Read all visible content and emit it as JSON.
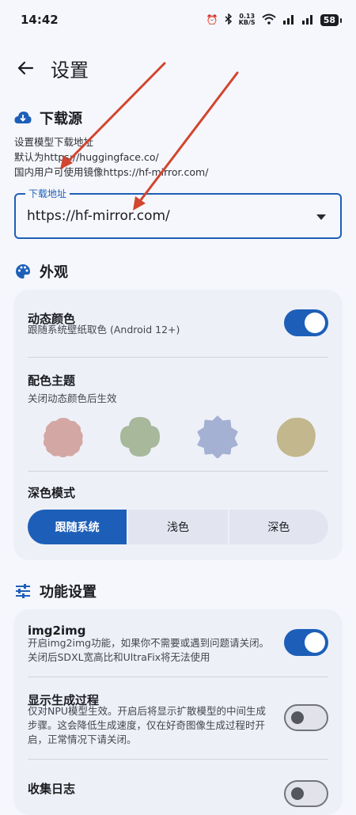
{
  "status_bar": {
    "time": "14:42",
    "net_speed": "0.13",
    "net_unit": "KB/S",
    "battery": "58"
  },
  "topbar": {
    "title": "设置"
  },
  "download": {
    "section_title": "下载源",
    "desc": [
      "设置模型下载地址",
      "默认为https://huggingface.co/",
      "国内用户可使用镜像https://hf-mirror.com/"
    ],
    "field_label": "下载地址",
    "field_value": "https://hf-mirror.com/"
  },
  "appearance": {
    "section_title": "外观",
    "dynamic_color": {
      "title": "动态颜色",
      "subtitle": "跟随系统壁纸取色 (Android 12+)",
      "enabled": true
    },
    "theme": {
      "title": "配色主题",
      "subtitle": "关闭动态颜色后生效",
      "swatches": [
        "#d3a7a4",
        "#a8b89b",
        "#a4b1d3",
        "#c2b78d"
      ]
    },
    "dark_mode": {
      "title": "深色模式",
      "options": [
        "跟随系统",
        "浅色",
        "深色"
      ],
      "selected": 0
    }
  },
  "features": {
    "section_title": "功能设置",
    "img2img": {
      "title": "img2img",
      "subtitle": [
        "开启img2img功能，如果你不需要或遇到问题请关闭。",
        "关闭后SDXL宽高比和UltraFix将无法使用"
      ],
      "enabled": true
    },
    "show_progress": {
      "title": "显示生成过程",
      "subtitle": [
        "仅对NPU模型生效。开启后将显示扩散模型的中间生成",
        "步骤。这会降低生成速度，仅在好奇图像生成过程时开",
        "启，正常情况下请关闭。"
      ],
      "enabled": false
    },
    "logs": {
      "title": "收集日志",
      "enabled": false
    }
  },
  "colors": {
    "accent": "#1d5fb8",
    "annotation": "#d2452f"
  }
}
